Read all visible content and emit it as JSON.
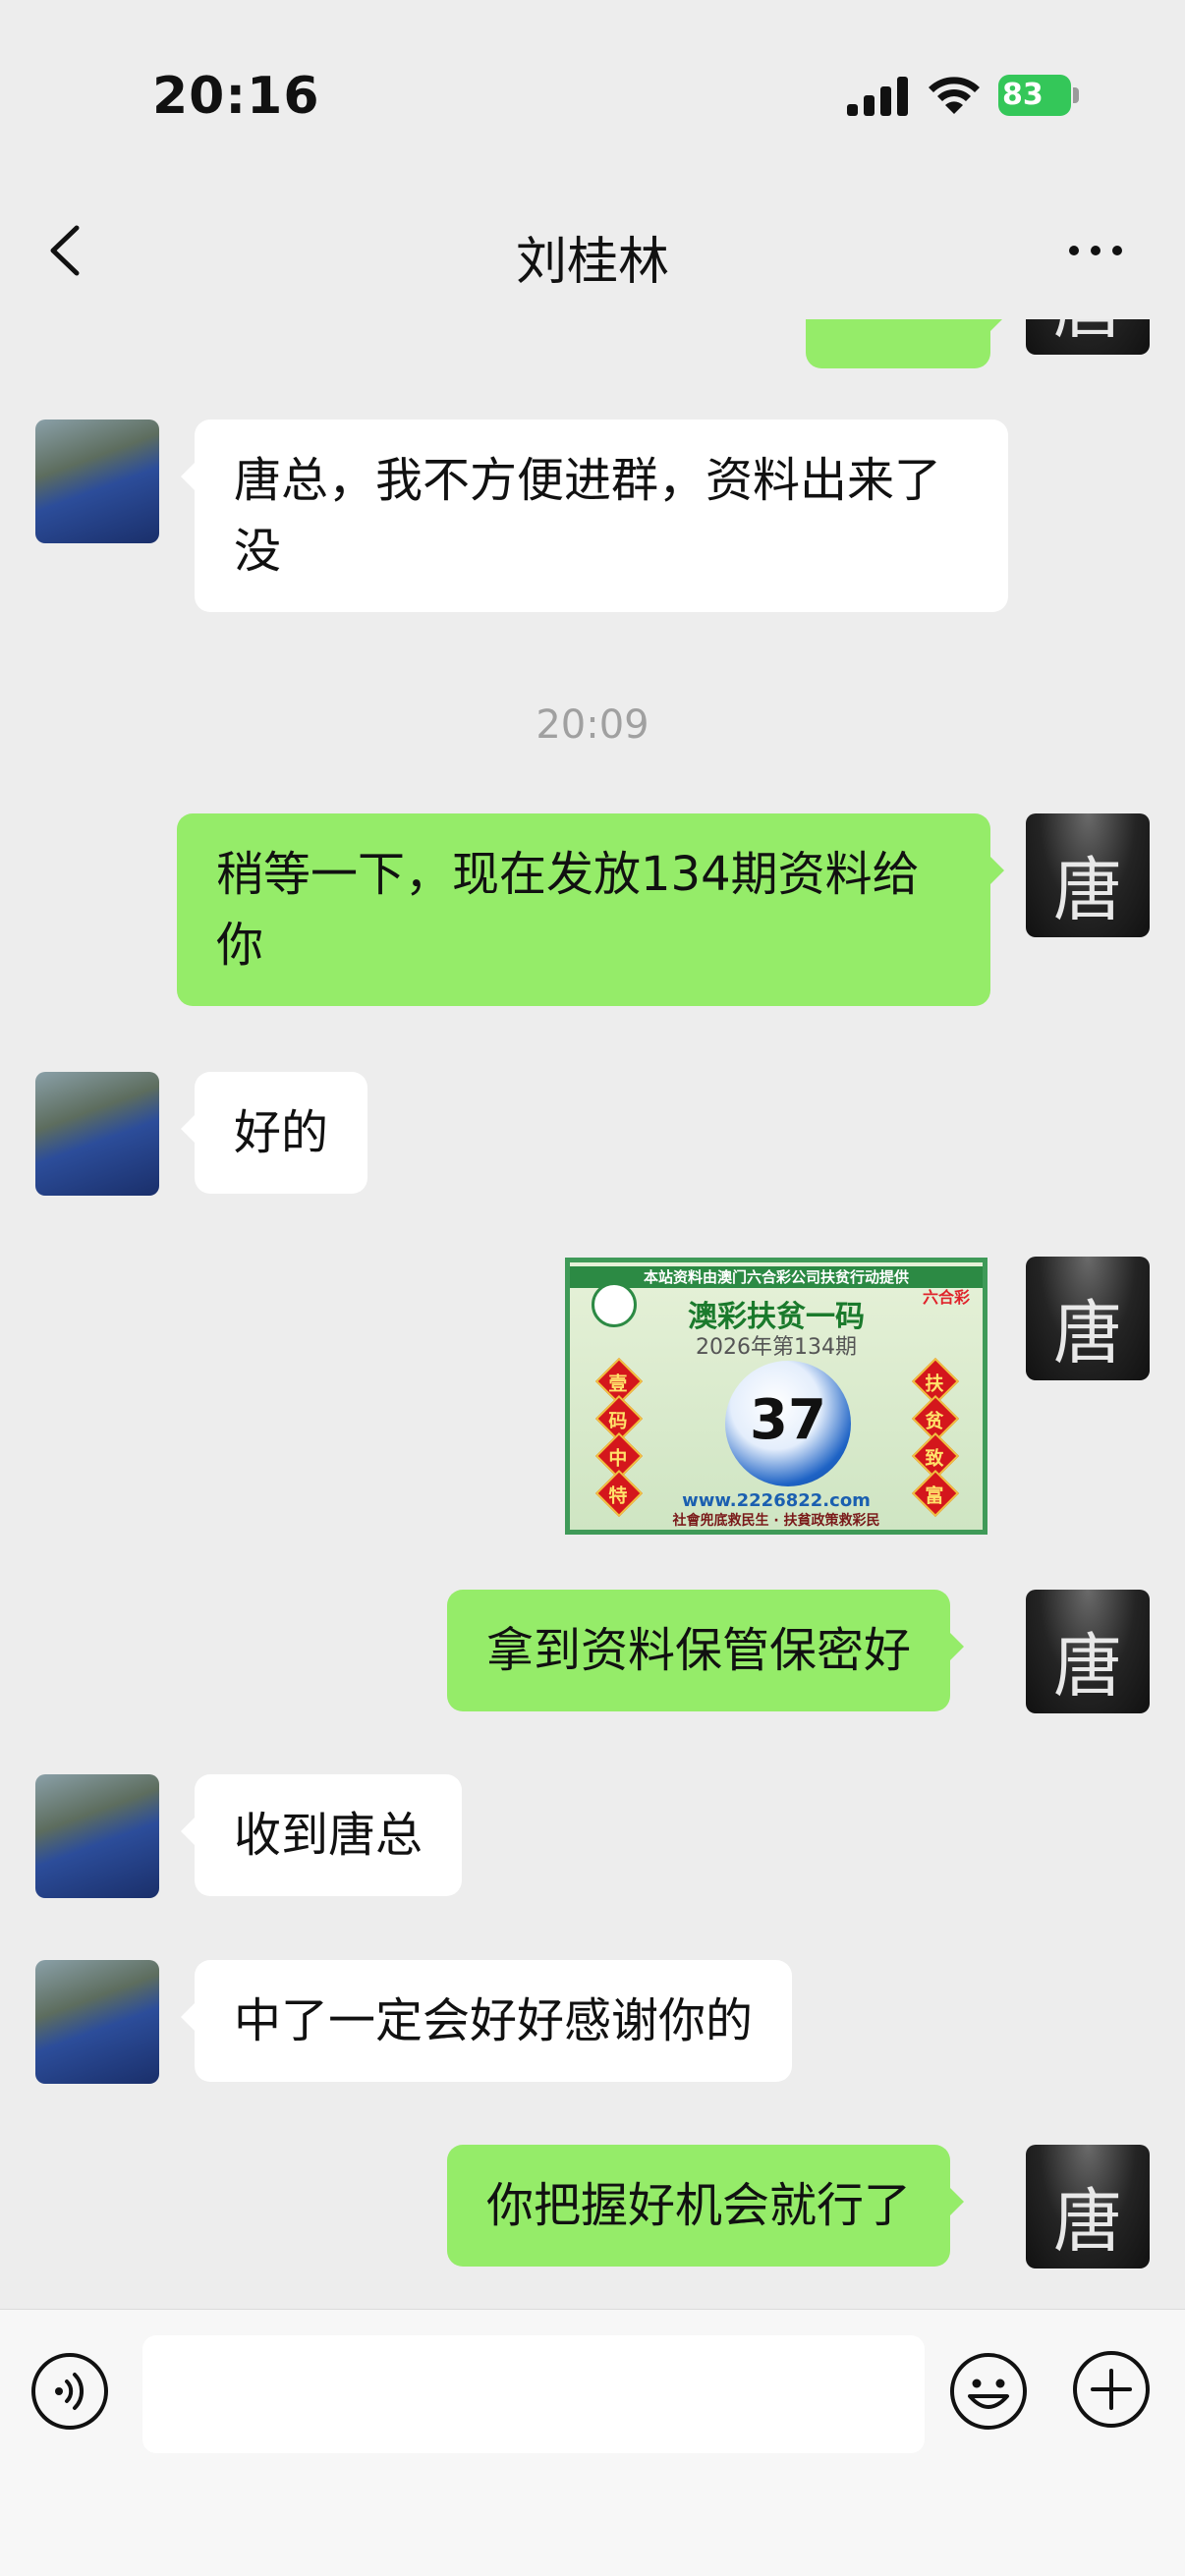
{
  "status_bar": {
    "time": "20:16",
    "battery": "83"
  },
  "nav": {
    "title": "刘桂林"
  },
  "messages": {
    "m1": "唐总，我不方便进群，资料出来了没",
    "ts": "20:09",
    "m2": "稍等一下，现在发放134期资料给你",
    "m3": "好的",
    "m5": "拿到资料保管保密好",
    "m6": "收到唐总",
    "m7": "中了一定会好好感谢你的",
    "m8": "你把握好机会就行了"
  },
  "avatar_out": {
    "char": "唐"
  },
  "image_card": {
    "top_line": "本站资料由澳门六合彩公司扶贫行动提供",
    "title": "澳彩扶贫一码",
    "issue": "2026年第134期",
    "number": "37",
    "left_chars": [
      "壹",
      "码",
      "中",
      "特"
    ],
    "right_chars": [
      "扶",
      "贫",
      "致",
      "富"
    ],
    "url": "www.2226822.com",
    "slogan": "社會兜底救民生 · 扶貧政策救彩民",
    "logo_right": "六合彩"
  },
  "input": {
    "placeholder": ""
  },
  "colors": {
    "outgoing": "#95ec69",
    "incoming": "#ffffff",
    "background": "#ededed"
  }
}
